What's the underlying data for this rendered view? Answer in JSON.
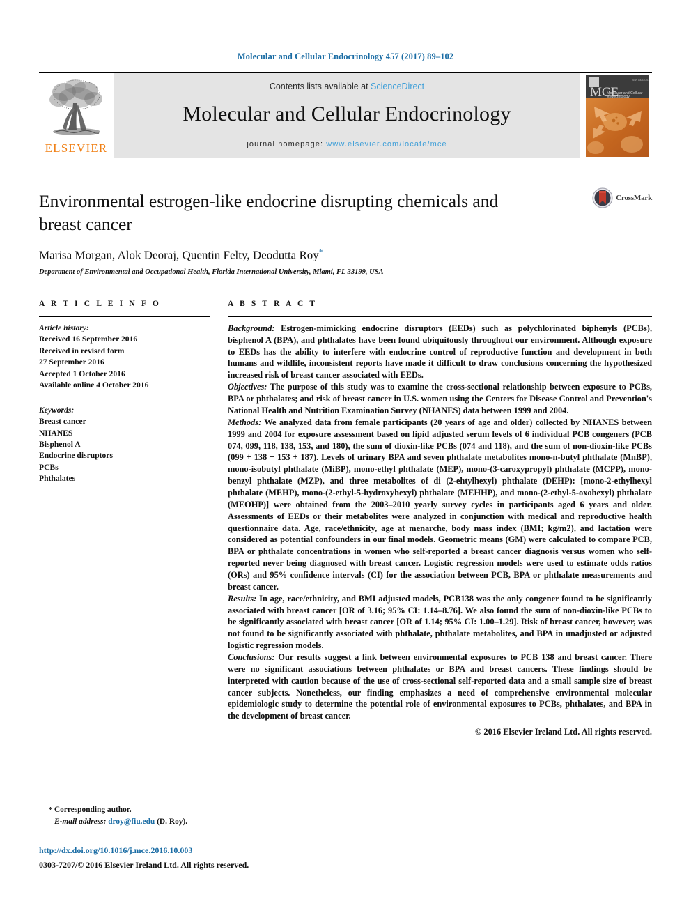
{
  "running_head": "Molecular and Cellular Endocrinology 457 (2017) 89–102",
  "masthead": {
    "publisher_name": "ELSEVIER",
    "contents_prefix": "Contents lists available at ",
    "contents_link": "ScienceDirect",
    "journal_title": "Molecular and Cellular Endocrinology",
    "homepage_prefix": "journal homepage: ",
    "homepage_url": "www.elsevier.com/locate/mce",
    "cover_abbrev": "MCE"
  },
  "article": {
    "title": "Environmental estrogen-like endocrine disrupting chemicals and breast cancer",
    "authors": "Marisa Morgan, Alok Deoraj, Quentin Felty, Deodutta Roy",
    "corresponding_marker": "*",
    "affiliation": "Department of Environmental and Occupational Health, Florida International University, Miami, FL 33199, USA",
    "crossmark_label": "CrossMark"
  },
  "article_info": {
    "heading": "A R T I C L E   I N F O",
    "history_label": "Article history:",
    "history": [
      "Received 16 September 2016",
      "Received in revised form",
      "27 September 2016",
      "Accepted 1 October 2016",
      "Available online 4 October 2016"
    ],
    "keywords_label": "Keywords:",
    "keywords": [
      "Breast cancer",
      "NHANES",
      "Bisphenol A",
      "Endocrine disruptors",
      "PCBs",
      "Phthalates"
    ]
  },
  "abstract": {
    "heading": "A B S T R A C T",
    "sections": [
      {
        "label": "Background:",
        "text": " Estrogen-mimicking endocrine disruptors (EEDs) such as polychlorinated biphenyls (PCBs), bisphenol A (BPA), and phthalates have been found ubiquitously throughout our environment. Although exposure to EEDs has the ability to interfere with endocrine control of reproductive function and development in both humans and wildlife, inconsistent reports have made it difficult to draw conclusions concerning the hypothesized increased risk of breast cancer associated with EEDs."
      },
      {
        "label": "Objectives:",
        "text": " The purpose of this study was to examine the cross-sectional relationship between exposure to PCBs, BPA or phthalates; and risk of breast cancer in U.S. women using the Centers for Disease Control and Prevention's National Health and Nutrition Examination Survey (NHANES) data between 1999 and 2004."
      },
      {
        "label": "Methods:",
        "text": " We analyzed data from female participants (20 years of age and older) collected by NHANES between 1999 and 2004 for exposure assessment based on lipid adjusted serum levels of 6 individual PCB congeners (PCB 074, 099, 118, 138, 153, and 180), the sum of dioxin-like PCBs (074 and 118), and the sum of non-dioxin-like PCBs (099 + 138 + 153 + 187). Levels of urinary BPA and seven phthalate metabolites mono-n-butyl phthalate (MnBP), mono-isobutyl phthalate (MiBP), mono-ethyl phthalate (MEP), mono-(3-caroxypropyl) phthalate (MCPP), mono-benzyl phthalate (MZP), and three metabolites of di (2-ehtylhexyl) phthalate (DEHP): [mono-2-ethylhexyl phthalate (MEHP), mono-(2-ethyl-5-hydroxyhexyl) phthalate (MEHHP), and mono-(2-ethyl-5-oxohexyl) phthalate (MEOHP)] were obtained from the 2003–2010 yearly survey cycles in participants aged 6 years and older. Assessments of EEDs or their metabolites were analyzed in conjunction with medical and reproductive health questionnaire data. Age, race/ethnicity, age at menarche, body mass index (BMI; kg/m2), and lactation were considered as potential confounders in our final models. Geometric means (GM) were calculated to compare PCB, BPA or phthalate concentrations in women who self-reported a breast cancer diagnosis versus women who self-reported never being diagnosed with breast cancer. Logistic regression models were used to estimate odds ratios (ORs) and 95% confidence intervals (CI) for the association between PCB, BPA or phthalate measurements and breast cancer."
      },
      {
        "label": "Results:",
        "text": " In age, race/ethnicity, and BMI adjusted models, PCB138 was the only congener found to be significantly associated with breast cancer [OR of 3.16; 95% CI: 1.14–8.76]. We also found the sum of non-dioxin-like PCBs to be significantly associated with breast cancer [OR of 1.14; 95% CI: 1.00–1.29]. Risk of breast cancer, however, was not found to be significantly associated with phthalate, phthalate metabolites, and BPA in unadjusted or adjusted logistic regression models."
      },
      {
        "label": "Conclusions:",
        "text": " Our results suggest a link between environmental exposures to PCB 138 and breast cancer. There were no significant associations between phthalates or BPA and breast cancers. These findings should be interpreted with caution because of the use of cross-sectional self-reported data and a small sample size of breast cancer subjects. Nonetheless, our finding emphasizes a need of comprehensive environmental molecular epidemiologic study to determine the potential role of environmental exposures to PCBs, phthalates, and BPA in the development of breast cancer."
      }
    ],
    "copyright": "© 2016 Elsevier Ireland Ltd. All rights reserved."
  },
  "footer": {
    "corresponding_marker": "*",
    "corresponding_text": "Corresponding author.",
    "email_label": "E-mail address:",
    "email": "droy@fiu.edu",
    "email_suffix": "(D. Roy).",
    "doi": "http://dx.doi.org/10.1016/j.mce.2016.10.003",
    "issn_line": "0303-7207/© 2016 Elsevier Ireland Ltd. All rights reserved."
  },
  "colors": {
    "link_blue": "#1a6ca4",
    "sciencedirect_blue": "#3f9fd8",
    "elsevier_orange": "#f07f13",
    "masthead_gray": "#e4e4e4"
  }
}
